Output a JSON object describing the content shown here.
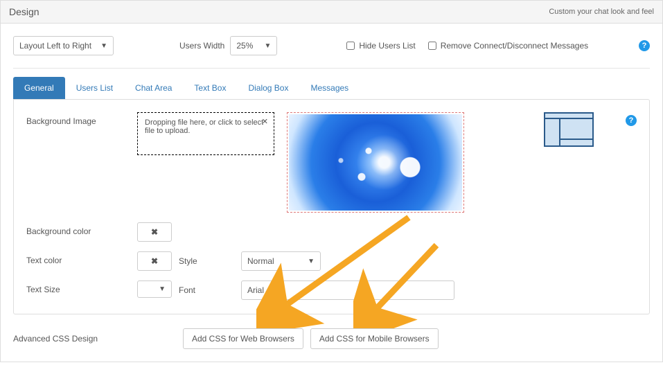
{
  "header": {
    "title": "Design",
    "subtitle": "Custom your chat look and feel"
  },
  "top": {
    "layoutSelectValue": "Layout Left to Right",
    "usersWidthLabel": "Users Width",
    "usersWidthValue": "25%",
    "hideUsersLabel": "Hide Users List",
    "removeConnectLabel": "Remove Connect/Disconnect Messages"
  },
  "tabs": {
    "items": [
      {
        "label": "General"
      },
      {
        "label": "Users List"
      },
      {
        "label": "Chat Area"
      },
      {
        "label": "Text Box"
      },
      {
        "label": "Dialog Box"
      },
      {
        "label": "Messages"
      }
    ]
  },
  "general": {
    "bgImageLabel": "Background Image",
    "dropzoneText": "Dropping file here, or click to select file to upload.",
    "bgColorLabel": "Background color",
    "textColorLabel": "Text color",
    "styleLabel": "Style",
    "styleValue": "Normal",
    "textSizeLabel": "Text Size",
    "textSizeValue": "",
    "fontLabel": "Font",
    "fontValue": "Arial"
  },
  "advanced": {
    "label": "Advanced CSS Design",
    "btnWeb": "Add CSS for Web Browsers",
    "btnMobile": "Add CSS for Mobile Browsers"
  }
}
